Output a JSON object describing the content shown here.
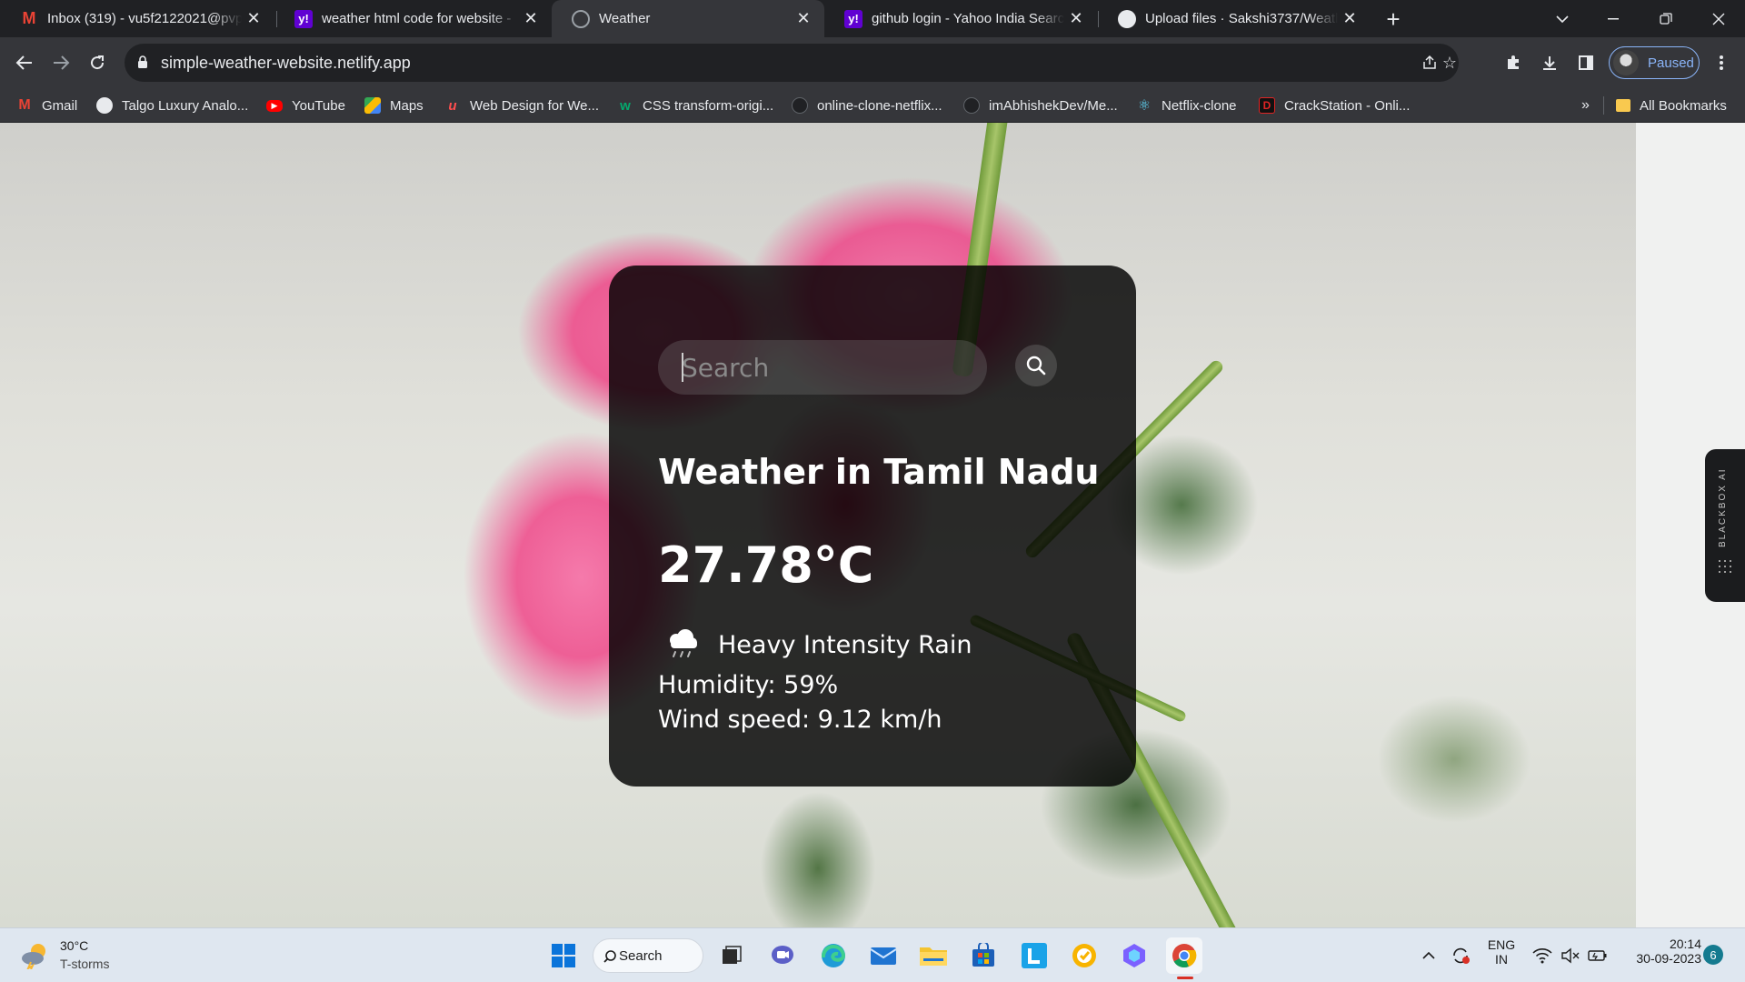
{
  "browser": {
    "tabs": [
      {
        "title": "Inbox (319) - vu5f2122021@pvp",
        "icon": "gmail-icon",
        "active": false
      },
      {
        "title": "weather html code for website -",
        "icon": "yahoo-icon",
        "active": false
      },
      {
        "title": "Weather",
        "icon": "globe-icon",
        "active": true
      },
      {
        "title": "github login - Yahoo India Searc",
        "icon": "yahoo-icon",
        "active": false
      },
      {
        "title": "Upload files · Sakshi3737/Weath",
        "icon": "github-icon",
        "active": false
      }
    ],
    "url": "simple-weather-website.netlify.app",
    "profile_label": "Paused",
    "bookmarks": [
      {
        "label": "Gmail",
        "icon": "gmail-icon"
      },
      {
        "label": "Talgo Luxury Analo...",
        "icon": "globe-icon"
      },
      {
        "label": "YouTube",
        "icon": "youtube-icon"
      },
      {
        "label": "Maps",
        "icon": "maps-icon"
      },
      {
        "label": "Web Design for We...",
        "icon": "bookmark-site-icon"
      },
      {
        "label": "CSS transform-origi...",
        "icon": "w3schools-icon"
      },
      {
        "label": "online-clone-netflix...",
        "icon": "github-icon"
      },
      {
        "label": "imAbhishekDev/Me...",
        "icon": "github-icon"
      },
      {
        "label": "Netflix-clone",
        "icon": "react-icon"
      },
      {
        "label": "CrackStation - Onli...",
        "icon": "crackstation-icon"
      }
    ],
    "more_bookmarks": "»",
    "all_bookmarks": "All Bookmarks"
  },
  "weather_app": {
    "search_placeholder": "Search",
    "title": "Weather in Tamil Nadu",
    "temperature": "27.78°C",
    "condition": "Heavy Intensity Rain",
    "humidity": "Humidity: 59%",
    "wind": "Wind speed: 9.12 km/h",
    "condition_icon": "rain-cloud-icon"
  },
  "extension": {
    "label": "BLACKBOX AI"
  },
  "taskbar": {
    "weather_temp": "30°C",
    "weather_cond": "T-storms",
    "search_label": "Search",
    "lang_top": "ENG",
    "lang_bottom": "IN",
    "time": "20:14",
    "date": "30-09-2023",
    "notifications": "6"
  }
}
